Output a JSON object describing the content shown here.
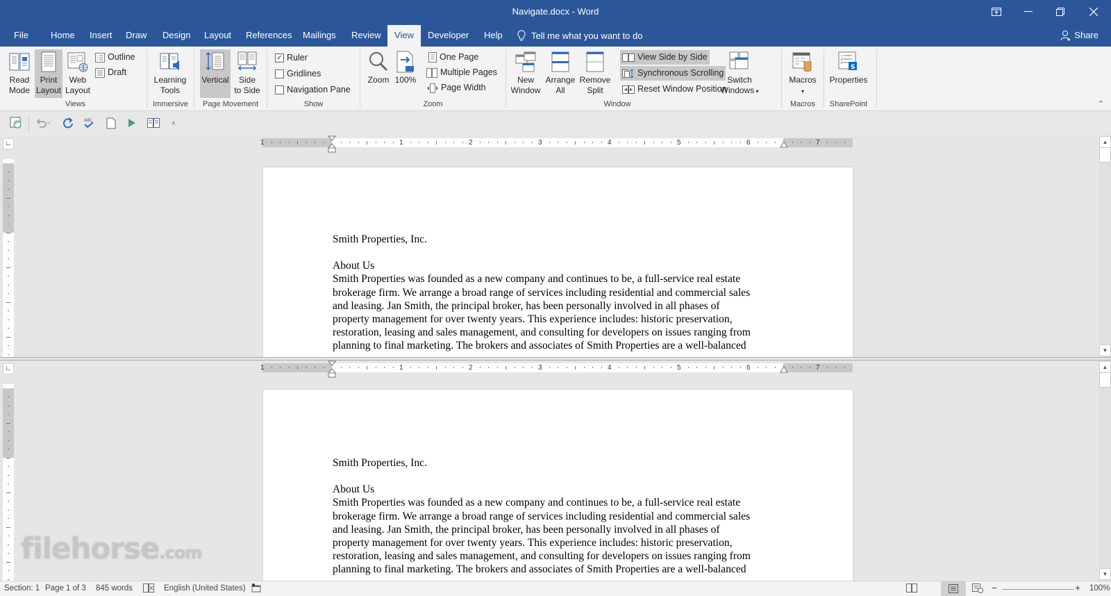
{
  "window": {
    "title": "Navigate.docx - Word",
    "controls": [
      "ribbon-display-options",
      "minimize",
      "restore",
      "close"
    ]
  },
  "tabs": [
    {
      "label": "File",
      "active": false
    },
    {
      "label": "Home",
      "active": false
    },
    {
      "label": "Insert",
      "active": false
    },
    {
      "label": "Draw",
      "active": false
    },
    {
      "label": "Design",
      "active": false
    },
    {
      "label": "Layout",
      "active": false
    },
    {
      "label": "References",
      "active": false
    },
    {
      "label": "Mailings",
      "active": false
    },
    {
      "label": "Review",
      "active": false
    },
    {
      "label": "View",
      "active": true
    },
    {
      "label": "Developer",
      "active": false
    },
    {
      "label": "Help",
      "active": false
    }
  ],
  "tell_me": {
    "placeholder": "Tell me what you want to do",
    "icon": "lightbulb-icon"
  },
  "share": {
    "label": "Share",
    "icon": "person-add-icon"
  },
  "ribbon": {
    "views": {
      "label": "Views",
      "read_mode": "Read Mode",
      "read_mode_l1": "Read",
      "read_mode_l2": "Mode",
      "print_layout_l1": "Print",
      "print_layout_l2": "Layout",
      "web_layout_l1": "Web",
      "web_layout_l2": "Layout",
      "outline": "Outline",
      "draft": "Draft",
      "selected": "Print Layout"
    },
    "immersive": {
      "label": "Immersive",
      "learning_tools_l1": "Learning",
      "learning_tools_l2": "Tools"
    },
    "page_movement": {
      "label": "Page Movement",
      "vertical": "Vertical",
      "side_l1": "Side",
      "side_l2": "to Side",
      "selected": "Vertical"
    },
    "show": {
      "label": "Show",
      "ruler": {
        "label": "Ruler",
        "checked": true
      },
      "gridlines": {
        "label": "Gridlines",
        "checked": false
      },
      "navigation_pane": {
        "label": "Navigation Pane",
        "checked": false
      }
    },
    "zoom": {
      "label": "Zoom",
      "zoom": "Zoom",
      "hundred": "100%",
      "one_page": "One Page",
      "multiple_pages": "Multiple Pages",
      "page_width": "Page Width"
    },
    "window": {
      "label": "Window",
      "new_window_l1": "New",
      "new_window_l2": "Window",
      "arrange_l1": "Arrange",
      "arrange_l2": "All",
      "remove_split_l1": "Remove",
      "remove_split_l2": "Split",
      "view_side_by_side": "View Side by Side",
      "synchronous_scrolling": "Synchronous Scrolling",
      "reset_window_position": "Reset Window Position",
      "switch_l1": "Switch",
      "switch_l2": "Windows"
    },
    "macros": {
      "label": "Macros",
      "macros": "Macros"
    },
    "sharepoint": {
      "label": "SharePoint",
      "properties": "Properties"
    }
  },
  "quick_access": [
    "save-sync-icon",
    "undo-icon",
    "redo-icon",
    "spelling-icon",
    "new-document-icon",
    "play-icon",
    "read-mode-icon",
    "customize-icon"
  ],
  "ruler": {
    "numbers": [
      "1",
      "1",
      "2",
      "3",
      "4",
      "5",
      "6",
      "7"
    ]
  },
  "document": {
    "company": "Smith Properties, Inc.",
    "heading": "About Us",
    "lines": [
      "Smith Properties was founded as a new company and continues to be, a full-service real estate",
      "brokerage firm. We arrange a broad range of services including residential and commercial sales",
      "and leasing. Jan Smith, the principal broker, has been personally involved in all phases of",
      "property management for over twenty years. This experience includes: historic preservation,",
      "restoration, leasing and sales management, and consulting for developers on issues ranging from",
      "planning to final marketing. The brokers and associates of Smith Properties are a well-balanced"
    ]
  },
  "status": {
    "section": "Section: 1",
    "page": "Page 1 of 3",
    "words": "845 words",
    "language": "English (United States)",
    "zoom_percent": "100%",
    "zoom_level": 100
  },
  "watermark": {
    "main": "filehorse",
    "suffix": ".com"
  }
}
